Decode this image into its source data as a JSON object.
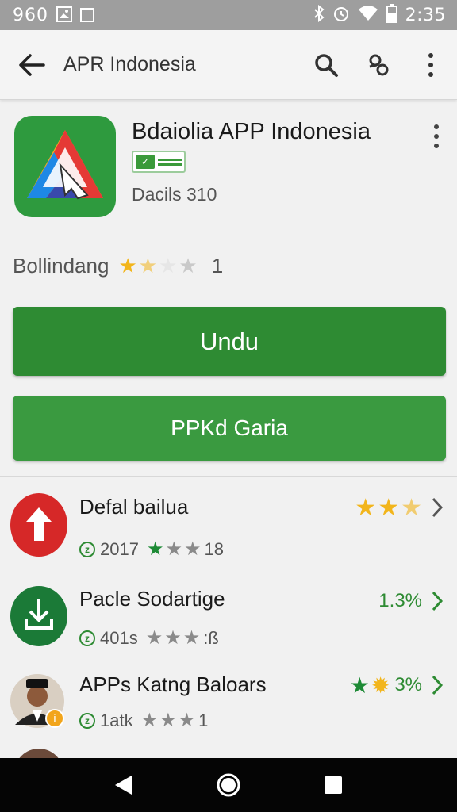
{
  "status_bar": {
    "left_text": "960",
    "time": "2:35",
    "icons": [
      "image-icon",
      "square-icon",
      "bluetooth-icon",
      "alarm-icon",
      "wifi-icon",
      "battery-icon"
    ]
  },
  "app_bar": {
    "title": "APR Indonesia",
    "icons": [
      "back-arrow-icon",
      "search-icon",
      "share-icon",
      "more-vert-icon"
    ]
  },
  "app": {
    "name": "Bdaiolia APP Indonesia",
    "developer": "Dacils 310",
    "rating_label": "Bollindang",
    "rating_count": "1",
    "rating_stars": 1.5
  },
  "buttons": {
    "primary": "Undu",
    "secondary": "PPKd Garia"
  },
  "list": [
    {
      "title": "Defal bailua",
      "meta_text": "2017",
      "meta_suffix": "18",
      "right_text": "",
      "icon": "red-upload-icon"
    },
    {
      "title": "Pacle Sodartige",
      "meta_text": "401s",
      "meta_suffix": ":ß",
      "right_text": "1.3%",
      "icon": "green-download-icon"
    },
    {
      "title": "APPs Katng Baloars",
      "meta_text": "1atk",
      "meta_suffix": "1",
      "right_text": "3%",
      "icon": "avatar-icon"
    }
  ],
  "nav": {
    "icons": [
      "back-triangle-icon",
      "home-circle-icon",
      "recents-square-icon"
    ]
  },
  "colors": {
    "accent": "#2e8b33",
    "star": "#f2b51b",
    "status_bar": "#9e9e9e"
  }
}
